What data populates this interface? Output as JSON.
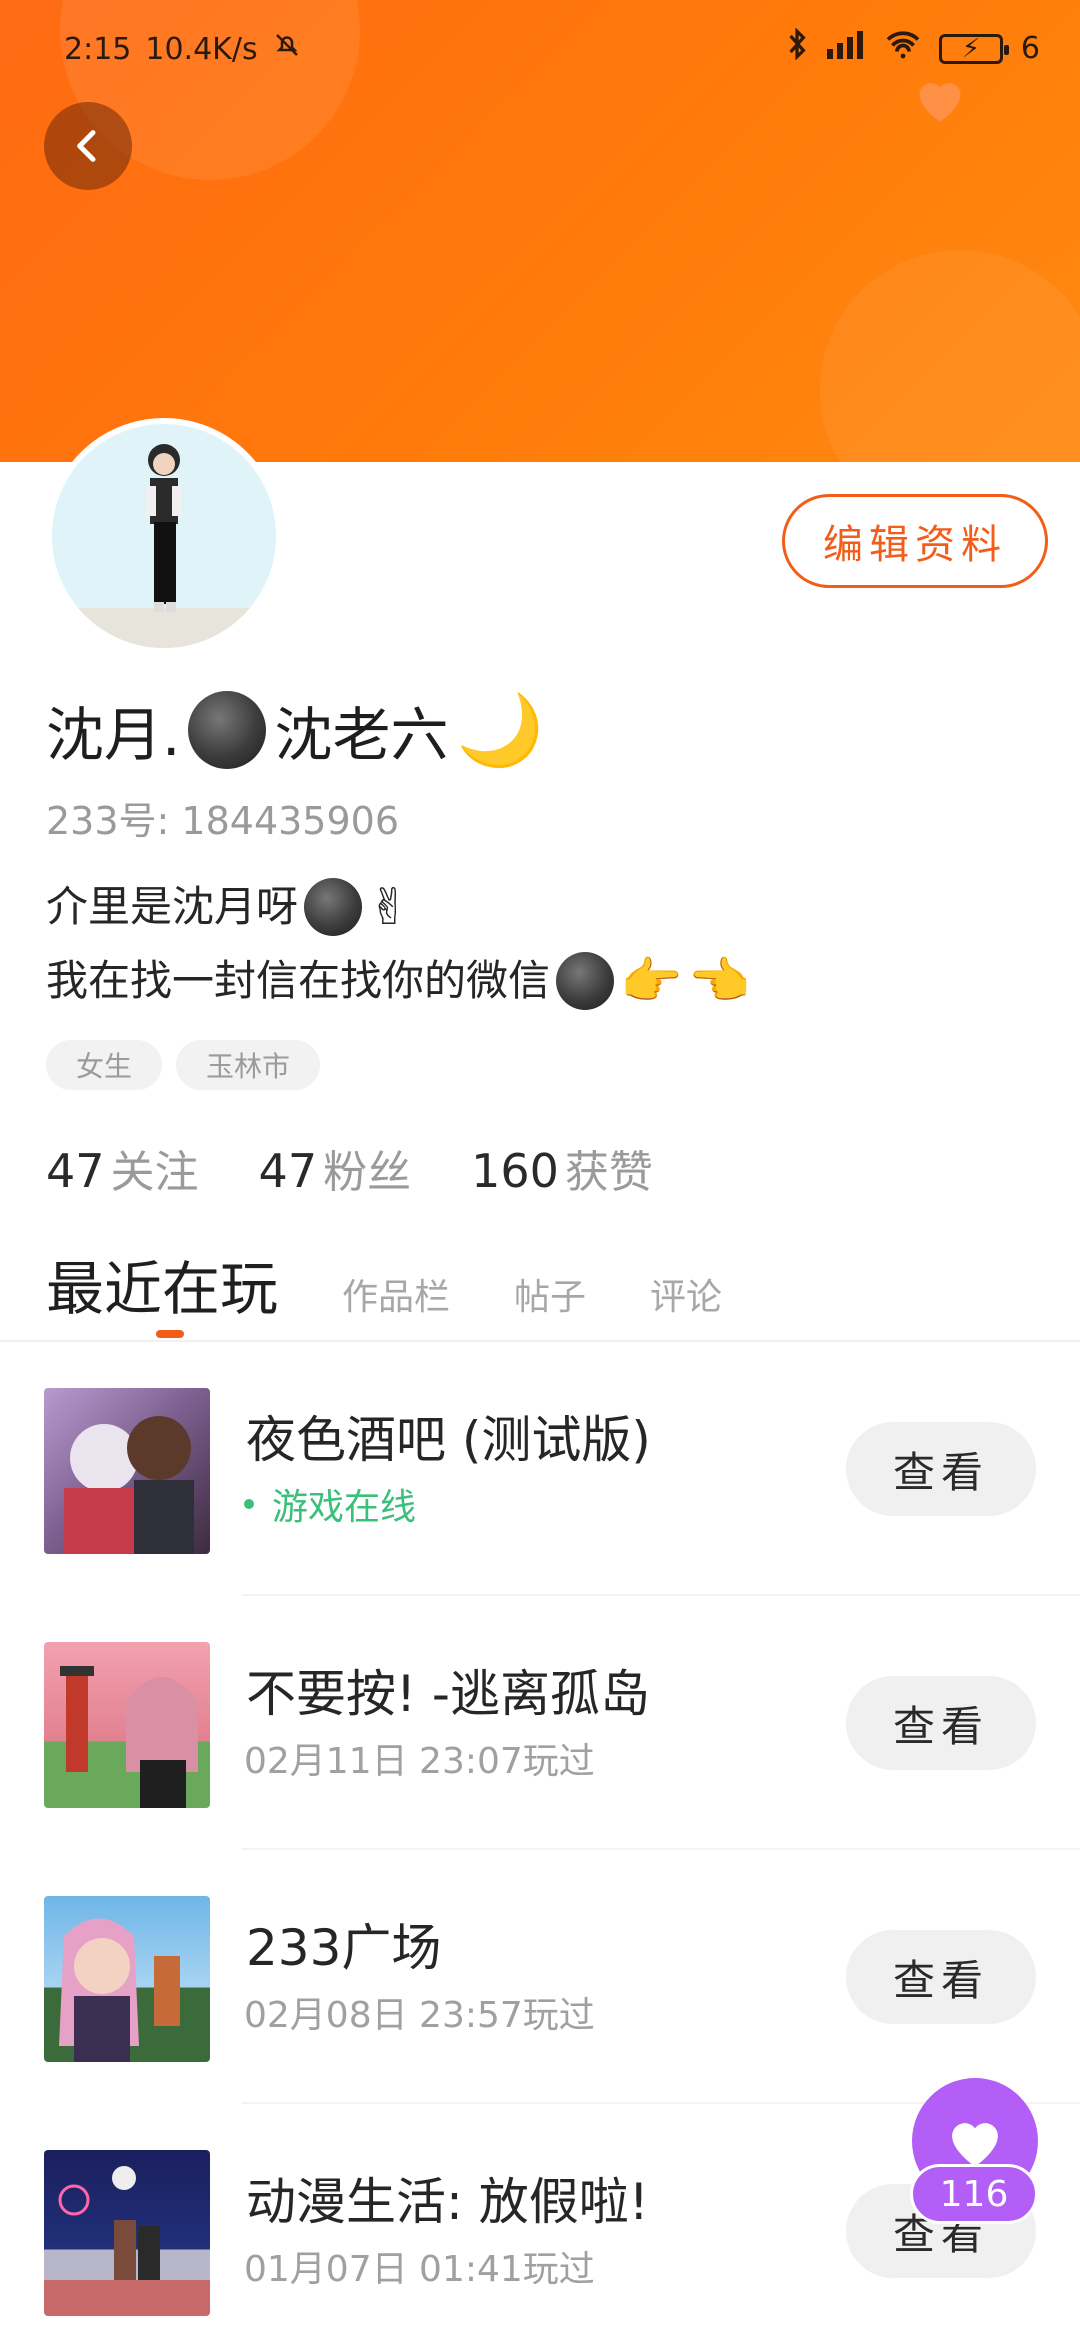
{
  "status_bar": {
    "time": "2:15",
    "speed": "10.4K/s",
    "battery": "6"
  },
  "profile": {
    "edit_label": "编辑资料",
    "nickname_part1": "沈月.",
    "nickname_part2": "沈老六",
    "uid": "233号: 184435906",
    "bio_line1": "介里是沈月呀",
    "bio_line2": "我在找一封信在找你的微信",
    "tags": [
      "女生",
      "玉林市"
    ],
    "stats": [
      {
        "num": "47",
        "label": "关注"
      },
      {
        "num": "47",
        "label": "粉丝"
      },
      {
        "num": "160",
        "label": "获赞"
      }
    ]
  },
  "tabs": [
    "最近在玩",
    "作品栏",
    "帖子",
    "评论"
  ],
  "games": [
    {
      "title": "夜色酒吧 (测试版)",
      "sub": "游戏在线",
      "online": true,
      "button": "查看",
      "theme": [
        "#b99ad0",
        "#3d2b3f"
      ]
    },
    {
      "title": "不要按! -逃离孤岛",
      "sub": "02月11日 23:07玩过",
      "online": false,
      "button": "查看",
      "theme": [
        "#f3a1b0",
        "#6aa85b"
      ]
    },
    {
      "title": "233广场",
      "sub": "02月08日 23:57玩过",
      "online": false,
      "button": "查看",
      "theme": [
        "#6fb5e8",
        "#3b2e50"
      ]
    },
    {
      "title": "动漫生活: 放假啦!",
      "sub": "01月07日 01:41玩过",
      "online": false,
      "button": "查看",
      "theme": [
        "#20307a",
        "#b7b7c9"
      ]
    }
  ],
  "like": {
    "count": "116"
  },
  "colors": {
    "accent": "#f25d1a",
    "banner": "#ff7a0a",
    "online": "#3cbf7b",
    "like": "#b25ef7"
  }
}
